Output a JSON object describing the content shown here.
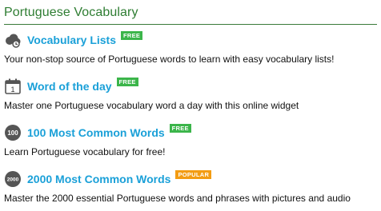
{
  "header": {
    "title": "Portuguese Vocabulary"
  },
  "colors": {
    "accent": "#1aa0d8",
    "title": "#2e7d32",
    "free_badge": "#3bb54a",
    "popular_badge": "#f39c12"
  },
  "items": [
    {
      "icon": "sheep-cloud-icon",
      "title": "Vocabulary Lists",
      "badge": "FREE",
      "description": "Your non-stop source of Portuguese words to learn with easy vocabulary lists!"
    },
    {
      "icon": "calendar-icon",
      "title": "Word of the day",
      "badge": "FREE",
      "description": "Master one Portuguese vocabulary word a day with this online widget",
      "icon_text": "1"
    },
    {
      "icon": "number-100-icon",
      "title": "100 Most Common Words",
      "badge": "FREE",
      "description": "Learn Portuguese vocabulary for free!",
      "icon_text": "100"
    },
    {
      "icon": "number-2000-icon",
      "title": "2000 Most Common Words",
      "badge": "POPULAR",
      "description": "Master the 2000 essential Portuguese words and phrases with pictures and audio",
      "icon_text": "2000"
    }
  ]
}
